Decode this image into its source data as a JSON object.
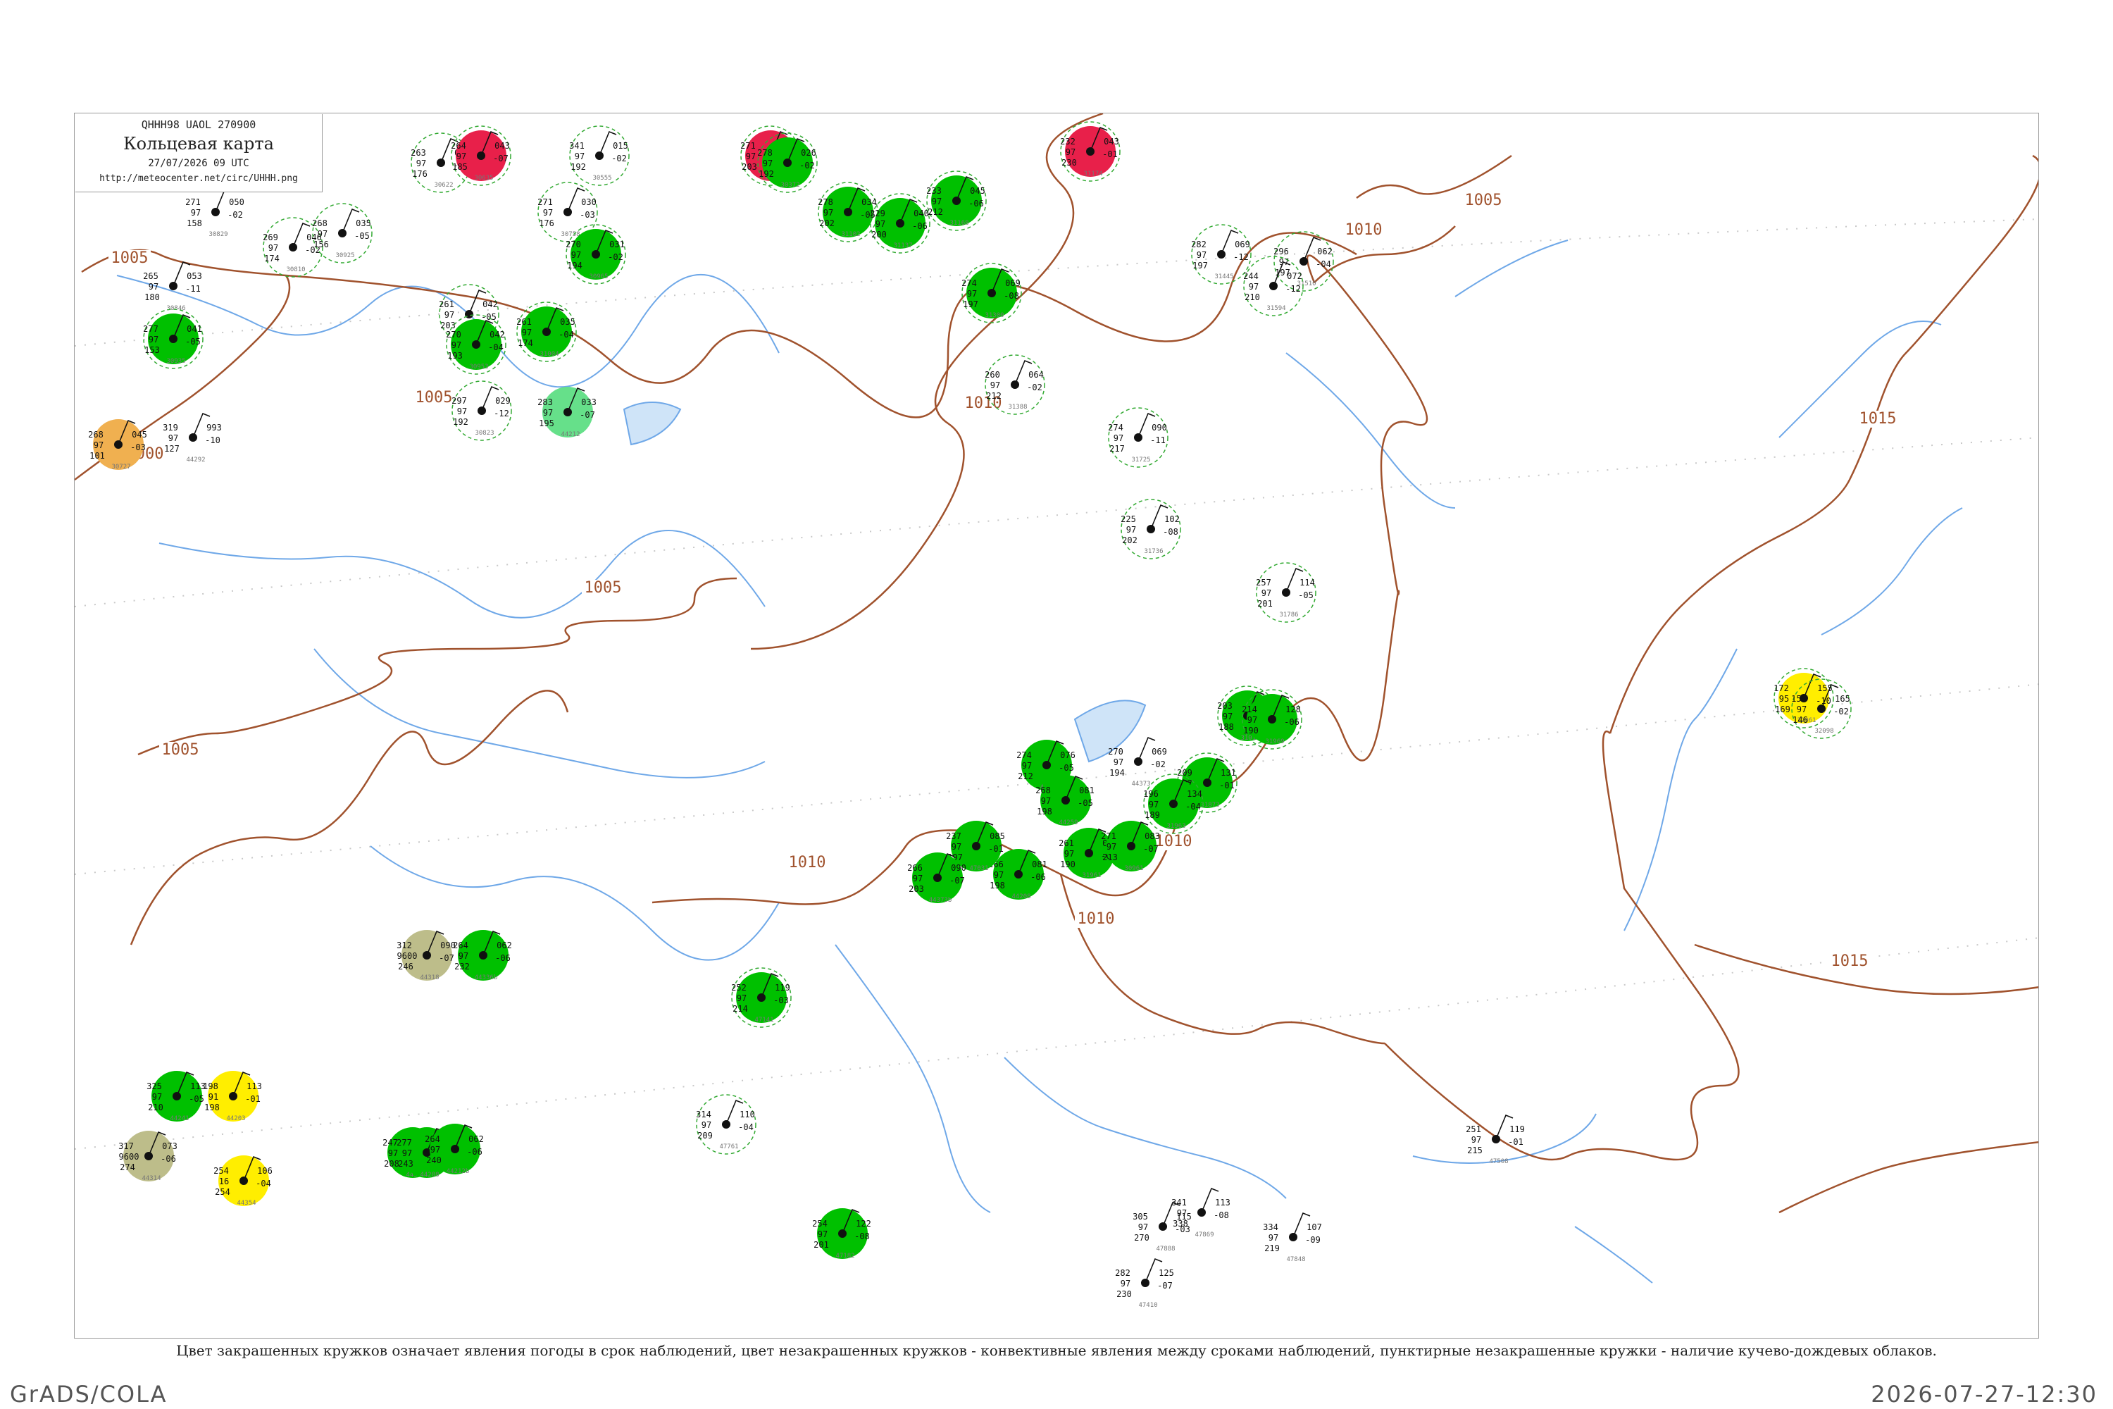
{
  "header": {
    "code": "QHHH98  UAOL  270900",
    "title": "Кольцевая карта",
    "time": "27/07/2026 09 UTC",
    "url": "http://meteocenter.net/circ/UHHH.png"
  },
  "caption": "Цвет закрашенных кружков означает явления погоды в срок наблюдений, цвет незакрашенных кружков - конвективные явления между сроками наблюдений, пунктирные незакрашенные кружки - наличие кучево-дождевых облаков.",
  "footer": {
    "left": "GrADS/COLA",
    "right": "2026-07-27-12:30"
  },
  "colors": {
    "isobar": "#a0522d",
    "river": "#6fa8e8",
    "rain": "#00c000",
    "thunder": "#e8204a",
    "shower": "#ffee00",
    "fog": "#bdbd8a",
    "smoke": "#f0b050",
    "mist": "#66e08a",
    "cb": "#33aa33",
    "convective": "#cc2244"
  },
  "isobar_labels": [
    {
      "text": "1005"
    },
    {
      "text": "1000"
    },
    {
      "text": "1005"
    },
    {
      "text": "1005"
    },
    {
      "text": "1005"
    },
    {
      "text": "1010"
    },
    {
      "text": "1010"
    },
    {
      "text": "1005"
    },
    {
      "text": "1010"
    },
    {
      "text": "1010"
    },
    {
      "text": "1010"
    },
    {
      "text": "1015"
    },
    {
      "text": "1015"
    }
  ],
  "stations": [
    {
      "id": "30829",
      "a": "271",
      "b": "050",
      "c": "97",
      "d": "-02",
      "e": "158",
      "phen": "none",
      "cb": false
    },
    {
      "id": "30810",
      "a": "269",
      "b": "046",
      "c": "97",
      "d": "-02",
      "e": "174",
      "phen": "none",
      "cb": true
    },
    {
      "id": "30846",
      "a": "265",
      "b": "053",
      "c": "97",
      "d": "-11",
      "e": "180",
      "phen": "none",
      "cb": false
    },
    {
      "id": "30935",
      "a": "277",
      "b": "041",
      "c": "97",
      "d": "-05",
      "e": "153",
      "phen": "rain",
      "cb": true
    },
    {
      "id": "30727",
      "a": "268",
      "b": "045",
      "c": "97",
      "d": "-03",
      "e": "101",
      "phen": "smoke",
      "cb": false
    },
    {
      "id": "44292",
      "a": "319",
      "b": "993",
      "c": "97",
      "d": "-10",
      "e": "127",
      "phen": "none",
      "cb": false
    },
    {
      "id": "30925",
      "a": "268",
      "b": "035",
      "c": "97",
      "d": "-05",
      "e": "156",
      "phen": "none",
      "cb": true
    },
    {
      "id": "30622",
      "a": "263",
      "b": "040",
      "c": "97",
      "d": "-06",
      "e": "176",
      "phen": "none",
      "cb": true
    },
    {
      "id": "30635",
      "a": "264",
      "b": "043",
      "c": "97",
      "d": "-07",
      "e": "185",
      "phen": "thunder",
      "cb": true
    },
    {
      "id": "30745",
      "a": "261",
      "b": "042",
      "c": "97",
      "d": "-05",
      "e": "203",
      "phen": "none",
      "cb": true
    },
    {
      "id": "30953",
      "a": "270",
      "b": "042",
      "c": "97",
      "d": "-04",
      "e": "193",
      "phen": "rain",
      "cb": true
    },
    {
      "id": "30823",
      "a": "297",
      "b": "029",
      "c": "97",
      "d": "-12",
      "e": "192",
      "phen": "none",
      "cb": true
    },
    {
      "id": "44212",
      "a": "283",
      "b": "033",
      "c": "97",
      "d": "-07",
      "e": "195",
      "phen": "mist",
      "cb": false
    },
    {
      "id": "30555",
      "a": "341",
      "b": "015",
      "c": "97",
      "d": "-02",
      "e": "192",
      "phen": "none",
      "cb": true
    },
    {
      "id": "30758",
      "a": "271",
      "b": "030",
      "c": "97",
      "d": "-03",
      "e": "176",
      "phen": "none",
      "cb": true
    },
    {
      "id": "30965",
      "a": "270",
      "b": "031",
      "c": "97",
      "d": "-02",
      "e": "194",
      "phen": "rain",
      "cb": true
    },
    {
      "id": "31004",
      "a": "261",
      "b": "035",
      "c": "97",
      "d": "-04",
      "e": "174",
      "phen": "rain",
      "cb": true
    },
    {
      "id": "30393",
      "a": "271",
      "b": "034",
      "c": "97",
      "d": "-02",
      "e": "203",
      "phen": "thunder",
      "cb": true
    },
    {
      "id": "30372",
      "a": "278",
      "b": "026",
      "c": "97",
      "d": "-02",
      "e": "192",
      "phen": "rain",
      "cb": true
    },
    {
      "id": "31102",
      "a": "278",
      "b": "034",
      "c": "97",
      "d": "-05",
      "e": "202",
      "phen": "rain",
      "cb": true
    },
    {
      "id": "31137",
      "a": "229",
      "b": "040",
      "c": "97",
      "d": "-06",
      "e": "200",
      "phen": "rain",
      "cb": true
    },
    {
      "id": "31168",
      "a": "233",
      "b": "045",
      "c": "97",
      "d": "-06",
      "e": "212",
      "phen": "rain",
      "cb": true
    },
    {
      "id": "31174",
      "a": "232",
      "b": "043",
      "c": "97",
      "d": "-01",
      "e": "230",
      "phen": "thunder",
      "cb": true
    },
    {
      "id": "31300",
      "a": "274",
      "b": "069",
      "c": "97",
      "d": "-08",
      "e": "197",
      "phen": "rain",
      "cb": true
    },
    {
      "id": "31388",
      "a": "260",
      "b": "064",
      "c": "97",
      "d": "-02",
      "e": "212",
      "phen": "none",
      "cb": true
    },
    {
      "id": "31445",
      "a": "282",
      "b": "069",
      "c": "97",
      "d": "-12",
      "e": "197",
      "phen": "none",
      "cb": true
    },
    {
      "id": "31510",
      "a": "296",
      "b": "062",
      "c": "97",
      "d": "-04",
      "e": "197",
      "phen": "none",
      "cb": true
    },
    {
      "id": "31594",
      "a": "244",
      "b": "072",
      "c": "97",
      "d": "-12",
      "e": "210",
      "phen": "none",
      "cb": true
    },
    {
      "id": "31725",
      "a": "274",
      "b": "090",
      "c": "97",
      "d": "-11",
      "e": "217",
      "phen": "none",
      "cb": true
    },
    {
      "id": "31736",
      "a": "225",
      "b": "102",
      "c": "97",
      "d": "-08",
      "e": "202",
      "phen": "none",
      "cb": true
    },
    {
      "id": "31786",
      "a": "257",
      "b": "114",
      "c": "97",
      "d": "-05",
      "e": "201",
      "phen": "none",
      "cb": true
    },
    {
      "id": "31873",
      "a": "209",
      "b": "131",
      "c": "97",
      "d": "-01",
      "e": "197",
      "phen": "rain",
      "cb": true
    },
    {
      "id": "31915",
      "a": "203",
      "b": "136",
      "c": "97",
      "d": "-10",
      "e": "188",
      "phen": "rain",
      "cb": true
    },
    {
      "id": "31963",
      "a": "196",
      "b": "134",
      "c": "97",
      "d": "-04",
      "e": "189",
      "phen": "rain",
      "cb": true
    },
    {
      "id": "31969",
      "a": "214",
      "b": "128",
      "c": "97",
      "d": "-06",
      "e": "190",
      "phen": "rain",
      "cb": true
    },
    {
      "id": "32061",
      "a": "172",
      "b": "155",
      "c": "95",
      "d": "-10",
      "e": "169",
      "phen": "shower",
      "cb": true
    },
    {
      "id": "32098",
      "a": "155",
      "b": "165",
      "c": "97",
      "d": "-02",
      "e": "146",
      "phen": "none",
      "cb": true
    },
    {
      "id": "44373",
      "a": "270",
      "b": "069",
      "c": "97",
      "d": "-02",
      "e": "194",
      "phen": "none",
      "cb": false
    },
    {
      "id": "44304",
      "a": "274",
      "b": "076",
      "c": "97",
      "d": "-05",
      "e": "212",
      "phen": "rain",
      "cb": false
    },
    {
      "id": "44259",
      "a": "268",
      "b": "081",
      "c": "97",
      "d": "-05",
      "e": "198",
      "phen": "rain",
      "cb": false
    },
    {
      "id": "44208",
      "a": "266",
      "b": "081",
      "c": "97",
      "d": "-06",
      "e": "198",
      "phen": "rain",
      "cb": false
    },
    {
      "id": "47031",
      "a": "237",
      "b": "085",
      "c": "97",
      "d": "-01",
      "e": "197",
      "phen": "rain",
      "cb": false
    },
    {
      "id": "31961",
      "a": "261",
      "b": "094",
      "c": "97",
      "d": "-04",
      "e": "190",
      "phen": "rain",
      "cb": false
    },
    {
      "id": "30961",
      "a": "271",
      "b": "083",
      "c": "97",
      "d": "-07",
      "e": "213",
      "phen": "rain",
      "cb": false
    },
    {
      "id": "44373b",
      "a": "266",
      "b": "090",
      "c": "97",
      "d": "-07",
      "e": "203",
      "phen": "rain",
      "cb": false
    },
    {
      "id": "44336",
      "a": "247",
      "b": "085",
      "c": "97",
      "d": "-04",
      "e": "208",
      "phen": "rain",
      "cb": false
    },
    {
      "id": "44318",
      "a": "312",
      "b": "090",
      "c": "9600",
      "d": "-07",
      "e": "246",
      "phen": "fog",
      "cb": false
    },
    {
      "id": "44354",
      "a": "254",
      "b": "106",
      "c": "16",
      "d": "-04",
      "e": "254",
      "phen": "shower",
      "cb": false
    },
    {
      "id": "44203",
      "a": "198",
      "b": "113",
      "c": "91",
      "d": "-01",
      "e": "198",
      "phen": "shower",
      "cb": false
    },
    {
      "id": "44241",
      "a": "325",
      "b": "113",
      "c": "97",
      "d": "-05",
      "e": "210",
      "phen": "rain",
      "cb": false
    },
    {
      "id": "44288",
      "a": "277",
      "b": "113",
      "c": "97",
      "d": "-05",
      "e": "243",
      "phen": "rain",
      "cb": false
    },
    {
      "id": "44336b",
      "a": "264",
      "b": "062",
      "c": "97",
      "d": "-06",
      "e": "232",
      "phen": "rain",
      "cb": false
    },
    {
      "id": "44212b",
      "a": "264",
      "b": "062",
      "c": "97",
      "d": "-06",
      "e": "240",
      "phen": "rain",
      "cb": false
    },
    {
      "id": "44314",
      "a": "317",
      "b": "073",
      "c": "9600",
      "d": "-06",
      "e": "274",
      "phen": "fog",
      "cb": false
    },
    {
      "id": "47182",
      "a": "254",
      "b": "122",
      "c": "97",
      "d": "-08",
      "e": "201",
      "phen": "rain",
      "cb": false
    },
    {
      "id": "47141",
      "a": "252",
      "b": "119",
      "c": "97",
      "d": "-03",
      "e": "214",
      "phen": "rain",
      "cb": true
    },
    {
      "id": "47761",
      "a": "314",
      "b": "110",
      "c": "97",
      "d": "-04",
      "e": "209",
      "phen": "none",
      "cb": true
    },
    {
      "id": "47869",
      "a": "341",
      "b": "113",
      "c": "97",
      "d": "-08",
      "e": "338",
      "phen": "none",
      "cb": false
    },
    {
      "id": "47888",
      "a": "305",
      "b": "115",
      "c": "97",
      "d": "-03",
      "e": "270",
      "phen": "none",
      "cb": false
    },
    {
      "id": "47848",
      "a": "334",
      "b": "107",
      "c": "97",
      "d": "-09",
      "e": "219",
      "phen": "none",
      "cb": false
    },
    {
      "id": "47508",
      "a": "251",
      "b": "119",
      "c": "97",
      "d": "-01",
      "e": "215",
      "phen": "none",
      "cb": false
    },
    {
      "id": "47410",
      "a": "282",
      "b": "125",
      "c": "97",
      "d": "-07",
      "e": "230",
      "phen": "none",
      "cb": false
    }
  ]
}
